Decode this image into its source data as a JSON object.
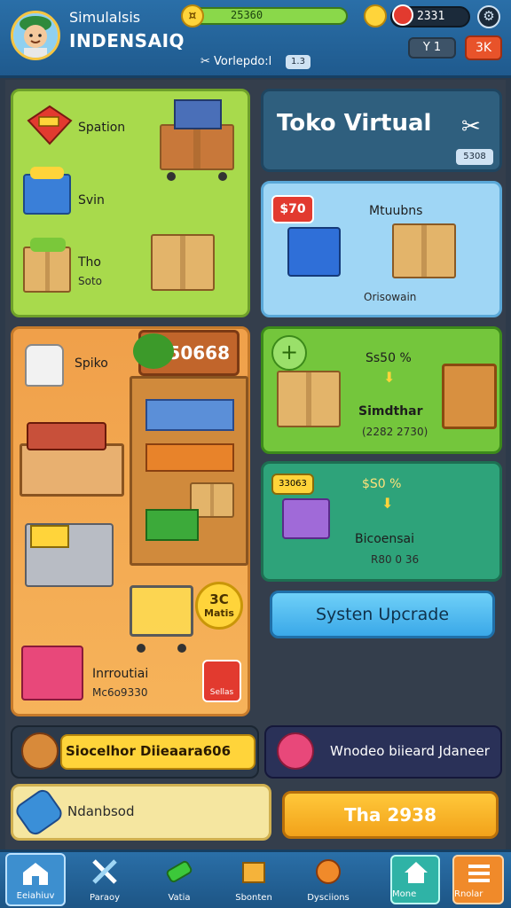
{
  "header": {
    "player_subtitle": "Simulalsis",
    "player_name": "INDENSAIQ",
    "coins": "25360",
    "time": "2331",
    "version_label": "Vorlepdo:l",
    "version_badge": "1.3",
    "btn_left": "Y 1",
    "btn_right": "3K"
  },
  "storage_panel": {
    "item1": "Spation",
    "item2": "Svin",
    "item3_title": "Tho",
    "item3_sub": "Soto"
  },
  "store_panel": {
    "label_spike": "Spiko",
    "price_tag": "50668",
    "gold_coin": "3C\nMatis",
    "gold_coin_top": "3C",
    "gold_coin_bottom": "Matis",
    "item_title": "Inrroutiai",
    "item_sub": "Mc6o9330",
    "red_button": "Sellas"
  },
  "title_panel": {
    "title": "Toko Virtual",
    "code": "5308"
  },
  "blue_panel": {
    "tag": "$70",
    "title": "Mtuubns",
    "sub": "Orisowain"
  },
  "green_panel": {
    "percent": "Ss50 %",
    "title": "Simdthar",
    "sub": "(2282 2730)"
  },
  "teal_panel": {
    "badge": "33063",
    "percent": "$S0 %",
    "title": "Bicoensai",
    "sub": "R80 0 36"
  },
  "upgrade_button": "Systen Upcrade",
  "strips": {
    "strip1": "Siocelhor Diieaara606",
    "strip2": "Wnodeo biieard Jdaneer",
    "strip3": "Ndanbsod",
    "action_button": "Tha 2938"
  },
  "nav": [
    {
      "label": "Eeiahiuv",
      "icon": "warehouse-icon"
    },
    {
      "label": "Paraoy",
      "icon": "tools-icon"
    },
    {
      "label": "Vatia",
      "icon": "battery-icon"
    },
    {
      "label": "Sbonten",
      "icon": "box-icon"
    },
    {
      "label": "Dysciions",
      "icon": "ball-icon"
    },
    {
      "label": "Mone",
      "icon": "home-icon"
    },
    {
      "label": "Rnolar",
      "icon": "menu-icon"
    }
  ],
  "colors": {
    "header_blue": "#2a6fa8",
    "storage_green": "#a8da4c",
    "store_orange": "#f0a04a",
    "accent_yellow": "#ffd43a",
    "upgrade_blue": "#3aa8e8"
  }
}
